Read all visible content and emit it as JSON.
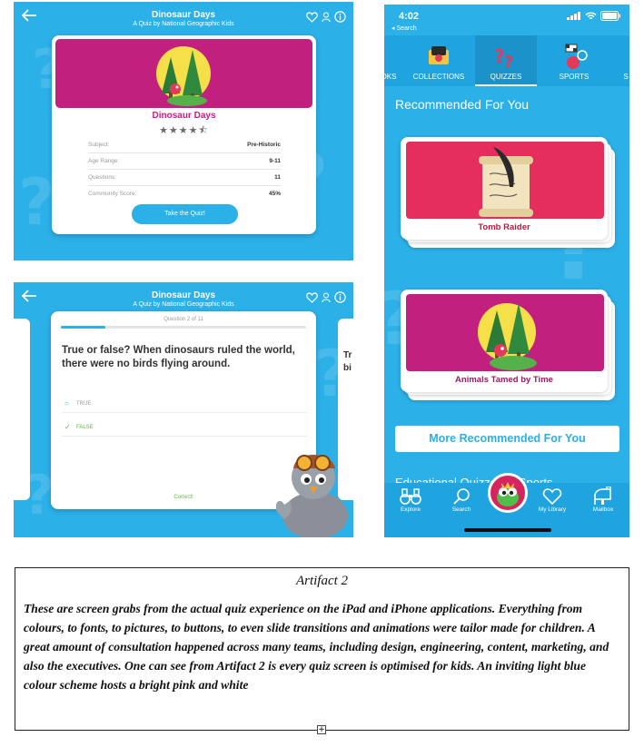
{
  "ipad_quiz_intro": {
    "title": "Dinosaur Days",
    "subtitle": "A Quiz by National Geographic Kids",
    "card_title": "Dinosaur Days",
    "rating_stars": "★★★★⯪",
    "rating_value": 4.5,
    "fields": [
      {
        "label": "Subject:",
        "value": "Pre-Historic"
      },
      {
        "label": "Age Range:",
        "value": "9-11"
      },
      {
        "label": "Questions:",
        "value": "11"
      },
      {
        "label": "Community Score:",
        "value": "45%"
      }
    ],
    "take_button": "Take the Quiz!",
    "icons": [
      "back-arrow-icon",
      "favorite-heart-icon",
      "user-icon",
      "info-icon"
    ]
  },
  "ipad_quiz_question": {
    "title": "Dinosaur Days",
    "subtitle": "A Quiz by National Geographic Kids",
    "question_counter": "Question 2 of 11",
    "progress_fraction": 0.18,
    "question": "True or false? When dinosaurs ruled the world, there were no birds flying around.",
    "options": [
      {
        "label": "TRUE",
        "state": "unselected"
      },
      {
        "label": "FALSE",
        "state": "correct"
      }
    ],
    "feedback": "Correct!",
    "peek_text_right": "Tr\nbi"
  },
  "iphone_quizzes": {
    "status_time": "4:02",
    "status_back": "◂ Search",
    "tabs": [
      {
        "label": "OKS",
        "active": false
      },
      {
        "label": "COLLECTIONS",
        "active": false
      },
      {
        "label": "QUIZZES",
        "active": true
      },
      {
        "label": "SPORTS",
        "active": false
      },
      {
        "label": "S",
        "active": false
      }
    ],
    "section_heading": "Recommended For You",
    "cards": [
      {
        "title": "Tomb Raider",
        "banner_color": "#e52e5b"
      },
      {
        "title": "Animals Tamed by Time",
        "banner_color": "#c2207e"
      }
    ],
    "more_button": "More Recommended For You",
    "next_section_partial": "Educational Quizzes in Sports",
    "bottom_tabs": [
      {
        "label": "Explore",
        "icon": "binoculars-icon"
      },
      {
        "label": "Search",
        "icon": "search-icon"
      },
      {
        "label": "",
        "icon": "avatar-icon"
      },
      {
        "label": "My Library",
        "icon": "heart-icon"
      },
      {
        "label": "Mailbox",
        "icon": "mailbox-icon"
      }
    ]
  },
  "caption": {
    "title": "Artifact 2",
    "body": "These are screen grabs from the actual quiz experience on the iPad and iPhone applications. Everything from colours, to fonts, to pictures, to buttons, to even slide transitions and animations were tailor made for children. A great amount of consultation happened across many teams, including design, engineering, content, marketing, and also the executives. One can see from Artifact 2 is every quiz screen is optimised for kids. An inviting light blue colour scheme hosts a bright pink and white"
  },
  "colors": {
    "app_blue": "#2bb0e8",
    "pink": "#c2207e",
    "red": "#e52e5b",
    "title_pink": "#d01b7b",
    "correct_green": "#5fb83a"
  }
}
